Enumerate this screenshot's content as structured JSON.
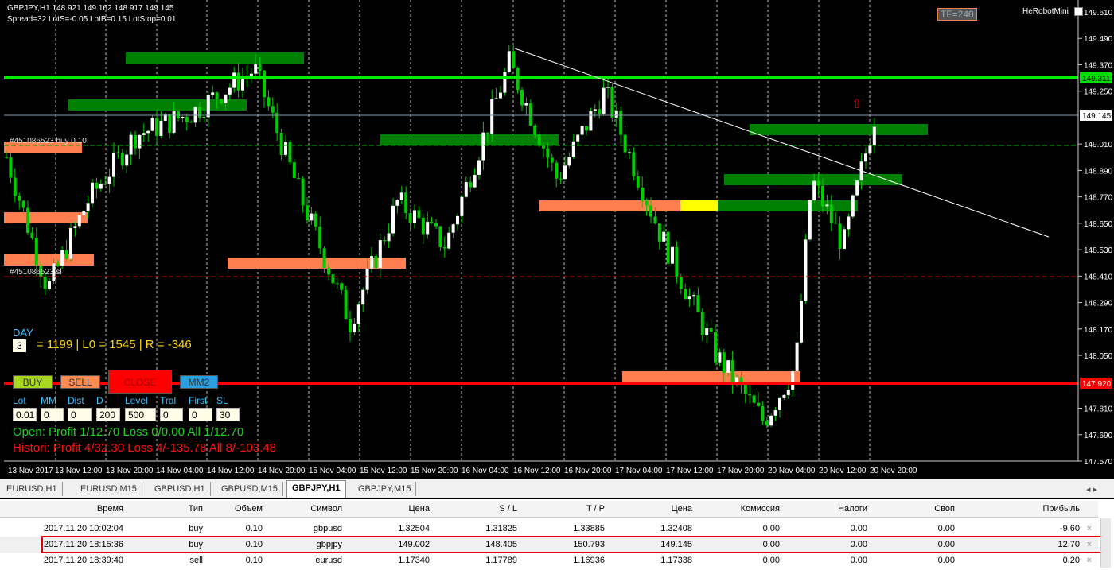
{
  "header": {
    "line1": "GBPJPY,H1  148.921 149.162 148.917 149.145",
    "line2": "Spread=32  LotS=-0.05  LotB=0.15  LotStop=0.01",
    "robot": "HeRobotMini",
    "tf": "TF=240"
  },
  "price_axis": [
    "149.610",
    "149.490",
    "149.370",
    "149.250",
    "149.010",
    "148.890",
    "148.770",
    "148.650",
    "148.530",
    "148.410",
    "148.290",
    "148.170",
    "148.050",
    "147.810",
    "147.690",
    "147.570"
  ],
  "price_tags": {
    "green": "149.311",
    "current": "149.145",
    "red": "147.920"
  },
  "time_axis": [
    "13 Nov 2017",
    "13 Nov 12:00",
    "13 Nov 20:00",
    "14 Nov 04:00",
    "14 Nov 12:00",
    "14 Nov 20:00",
    "15 Nov 04:00",
    "15 Nov 12:00",
    "15 Nov 20:00",
    "16 Nov 04:00",
    "16 Nov 12:00",
    "16 Nov 20:00",
    "17 Nov 04:00",
    "17 Nov 12:00",
    "17 Nov 20:00",
    "20 Nov 04:00",
    "20 Nov 12:00",
    "20 Nov 20:00"
  ],
  "order_labels": {
    "buy": "#451086523 buy 0.10",
    "sl": "#451086523 sl"
  },
  "panel": {
    "day_label": "DAY",
    "day_value": "3",
    "stats": "= 1199 | L0 = 1545 | R = -346",
    "buttons": {
      "buy": "BUY",
      "sell": "SELL",
      "close": "CLOSE",
      "mm": "MM2"
    },
    "fields": [
      {
        "label": "Lot",
        "value": "0.01"
      },
      {
        "label": "MM",
        "value": "0"
      },
      {
        "label": "Dist",
        "value": "0"
      },
      {
        "label": "D",
        "value": "200"
      },
      {
        "label": "Level",
        "value": "500"
      },
      {
        "label": "Tral",
        "value": "0"
      },
      {
        "label": "First",
        "value": "0"
      },
      {
        "label": "SL",
        "value": "30"
      }
    ],
    "open_line": "Open:  Profit 1/12.70  Loss 0/0.00  All 1/12.70",
    "history_line": "Histori: Profit 4/32.30  Loss 4/-135.78  All 8/-103.48"
  },
  "tabs": [
    "EURUSD,H1",
    "EURUSD,M15",
    "GBPUSD,H1",
    "GBPUSD,M15",
    "GBPJPY,H1",
    "GBPJPY,M15"
  ],
  "active_tab": "GBPJPY,H1",
  "trades": {
    "columns": [
      "Время",
      "Тип",
      "Объем",
      "Символ",
      "Цена",
      "S / L",
      "T / P",
      "Цена",
      "Комиссия",
      "Налоги",
      "Своп",
      "Прибыль"
    ],
    "rows": [
      [
        "2017.11.20 10:02:04",
        "buy",
        "0.10",
        "gbpusd",
        "1.32504",
        "1.31825",
        "1.33885",
        "1.32408",
        "0.00",
        "0.00",
        "0.00",
        "-9.60"
      ],
      [
        "2017.11.20 18:15:36",
        "buy",
        "0.10",
        "gbpjpy",
        "149.002",
        "148.405",
        "150.793",
        "149.145",
        "0.00",
        "0.00",
        "0.00",
        "12.70"
      ],
      [
        "2017.11.20 18:39:40",
        "sell",
        "0.10",
        "eurusd",
        "1.17340",
        "1.17789",
        "1.16936",
        "1.17338",
        "0.00",
        "0.00",
        "0.00",
        "0.20"
      ]
    ],
    "close_glyph": "×"
  },
  "colors": {
    "bull": "#ffffff",
    "bear": "#00cc00",
    "green_level": "#00ee00",
    "red_level": "#ff0000",
    "zone_green": "#008000",
    "zone_salmon": "#ff7f50",
    "label_yellow": "#ffff00",
    "panel_cyan": "#3cc0ff"
  }
}
